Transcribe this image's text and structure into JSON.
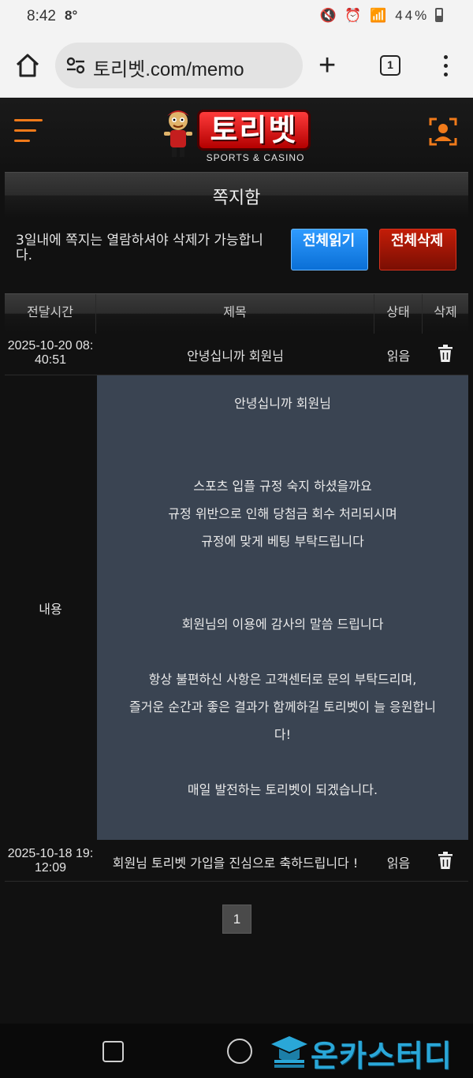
{
  "status_bar": {
    "time": "8:42",
    "temp": "8°",
    "battery": "44%"
  },
  "browser": {
    "url": "토리벳.com/memo",
    "tab_count": "1"
  },
  "site": {
    "brand": "토리벳",
    "tagline": "SPORTS & CASINO"
  },
  "page": {
    "title": "쪽지함",
    "notice": "3일내에 쪽지는 열람하셔야 삭제가 가능합니다.",
    "read_all_label": "전체읽기",
    "delete_all_label": "전체삭제"
  },
  "table": {
    "headers": {
      "time": "전달시간",
      "subject": "제목",
      "status": "상태",
      "delete": "삭제"
    },
    "rows": [
      {
        "time_line1": "2025-10-20 08:",
        "time_line2": "40:51",
        "subject": "안녕십니까 회원님",
        "status": "읽음"
      },
      {
        "time_line1": "2025-10-18 19:",
        "time_line2": "12:09",
        "subject": "회원님 토리벳 가입을 진심으로 축하드립니다 !",
        "status": "읽음"
      }
    ],
    "content_label": "내용",
    "content_lines": [
      "안녕십니까 회원님",
      "스포츠 입플 규정 숙지 하셨을까요",
      "규정 위반으로 인해 당첨금 회수 처리되시며",
      "규정에 맞게 베팅 부탁드립니다",
      "회원님의 이용에 감사의 말씀 드립니다",
      "항상 불편하신 사항은 고객센터로 문의 부탁드리며,",
      "즐거운 순간과 좋은 결과가 함께하길 토리벳이 늘 응원합니",
      "다!",
      "매일 발전하는 토리벳이 되겠습니다."
    ]
  },
  "pagination": {
    "current": "1"
  },
  "watermark": {
    "text": "온카스터디"
  },
  "colors": {
    "accent_orange": "#f07a1a",
    "button_blue": "#1a86ef",
    "button_red": "#a41506",
    "content_bg": "#3a4452"
  }
}
